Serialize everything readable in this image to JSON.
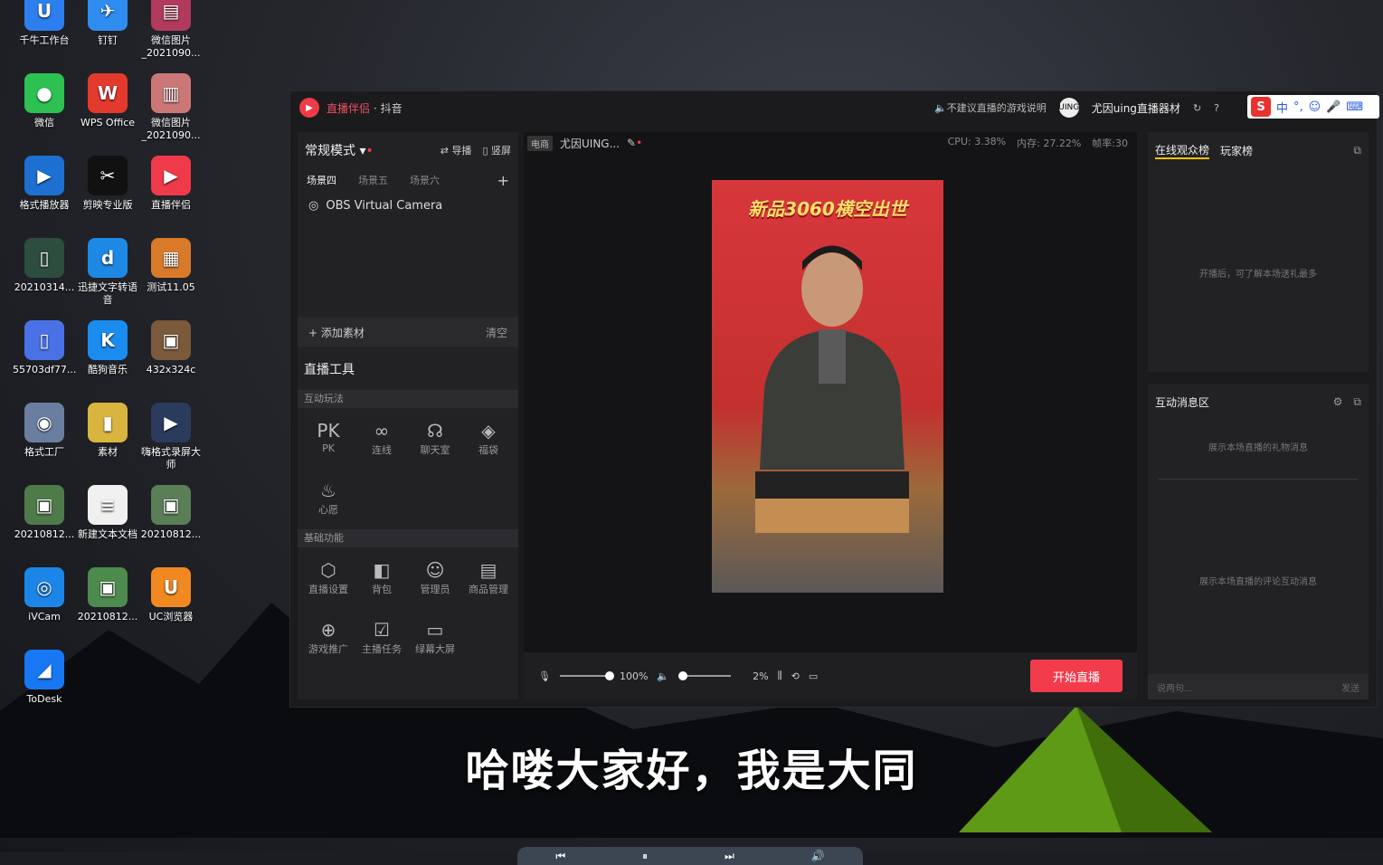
{
  "desktop": {
    "icons": [
      {
        "label": "千牛工作台",
        "glyph": "U",
        "color": "#2d7ff0"
      },
      {
        "label": "钉钉",
        "glyph": "✈",
        "color": "#2f8cf0"
      },
      {
        "label": "微信图片_2021090...",
        "glyph": "▤",
        "color": "#b23a5c"
      },
      {
        "label": "微信",
        "glyph": "●",
        "color": "#2dc152"
      },
      {
        "label": "WPS Office",
        "glyph": "W",
        "color": "#e43a2d"
      },
      {
        "label": "微信图片_2021090...",
        "glyph": "▥",
        "color": "#c77"
      },
      {
        "label": "格式播放器",
        "glyph": "▶",
        "color": "#1d6fd0"
      },
      {
        "label": "剪映专业版",
        "glyph": "✂",
        "color": "#111"
      },
      {
        "label": "直播伴侣",
        "glyph": "▶",
        "color": "#ef3a49"
      },
      {
        "label": "20210314...",
        "glyph": "▯",
        "color": "#2d4d3e"
      },
      {
        "label": "迅捷文字转语音",
        "glyph": "d",
        "color": "#1e88e5"
      },
      {
        "label": "测试11.05",
        "glyph": "▦",
        "color": "#d97a2b"
      },
      {
        "label": "55703df77...",
        "glyph": "▯",
        "color": "#4a72e6"
      },
      {
        "label": "酷狗音乐",
        "glyph": "K",
        "color": "#1a8cf0"
      },
      {
        "label": "432x324c",
        "glyph": "▣",
        "color": "#7a5a3a"
      },
      {
        "label": "格式工厂",
        "glyph": "◉",
        "color": "#6a7fa0"
      },
      {
        "label": "素材",
        "glyph": "▮",
        "color": "#d9b540"
      },
      {
        "label": "嗨格式录屏大师",
        "glyph": "▶",
        "color": "#2a3b5c"
      },
      {
        "label": "20210812...",
        "glyph": "▣",
        "color": "#4f7a4a"
      },
      {
        "label": "新建文本文档",
        "glyph": "≡",
        "color": "#f0f0f0"
      },
      {
        "label": "20210812...",
        "glyph": "▣",
        "color": "#5a7e56"
      },
      {
        "label": "iVCam",
        "glyph": "◎",
        "color": "#1c86e8"
      },
      {
        "label": "20210812...",
        "glyph": "▣",
        "color": "#4d8a4d"
      },
      {
        "label": "UC浏览器",
        "glyph": "U",
        "color": "#f08a20"
      },
      {
        "label": "ToDesk",
        "glyph": "◢",
        "color": "#1877f2"
      }
    ],
    "subtitle": "哈喽大家好，我是大同"
  },
  "window": {
    "app_name": "直播伴侣",
    "platform": "· 抖音",
    "notice": "不建议直播的游戏说明",
    "username": "尤因uing直播器材",
    "ime": [
      "中",
      "°,",
      "☺",
      "🎤",
      "⌨"
    ]
  },
  "left": {
    "mode": "常规模式",
    "guide": "导播",
    "vertical": "竖屏",
    "scene_tabs": [
      "场景四",
      "场景五",
      "场景六"
    ],
    "source": "OBS Virtual Camera",
    "add_material": "添加素材",
    "clear": "清空",
    "tools_title": "直播工具",
    "section_interactive": "互动玩法",
    "interactive_tools": [
      {
        "icon": "PK",
        "label": "PK"
      },
      {
        "icon": "∞",
        "label": "连线"
      },
      {
        "icon": "☊",
        "label": "聊天室"
      },
      {
        "icon": "◈",
        "label": "福袋"
      },
      {
        "icon": "♨",
        "label": "心愿"
      }
    ],
    "section_basic": "基础功能",
    "basic_tools": [
      {
        "icon": "⬡",
        "label": "直播设置"
      },
      {
        "icon": "◧",
        "label": "背包"
      },
      {
        "icon": "☺",
        "label": "管理员"
      },
      {
        "icon": "▤",
        "label": "商品管理"
      },
      {
        "icon": "⊕",
        "label": "游戏推广"
      },
      {
        "icon": "☑",
        "label": "主播任务"
      },
      {
        "icon": "▭",
        "label": "绿幕大屏"
      }
    ]
  },
  "center": {
    "tag": "电商",
    "room_title": "尤因UING...",
    "cpu": "CPU: 3.38%",
    "memory": "内存: 27.22%",
    "fps": "帧率:30",
    "preview_banner": "新品3060横空出世",
    "mic_volume": "100%",
    "speaker_volume": "2%",
    "start_live": "开始直播"
  },
  "right": {
    "tab_audience": "在线观众榜",
    "tab_players": "玩家榜",
    "audience_empty": "开播后，可了解本场送礼最多",
    "message_title": "互动消息区",
    "gift_empty": "展示本场直播的礼物消息",
    "comment_empty": "展示本场直播的评论互动消息",
    "say_placeholder": "说两句...",
    "send": "发送"
  }
}
